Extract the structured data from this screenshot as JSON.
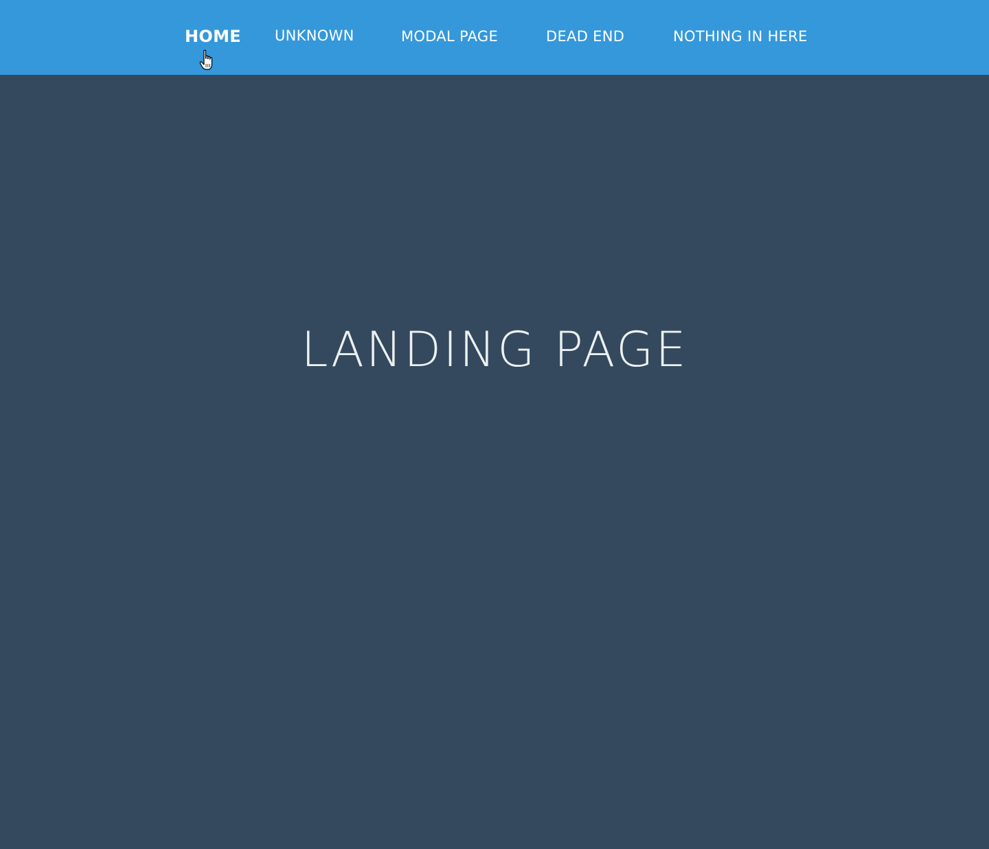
{
  "nav": {
    "items": [
      {
        "label": "HOME",
        "active": true
      },
      {
        "label": "UNKNOWN",
        "active": false
      },
      {
        "label": "MODAL PAGE",
        "active": false
      },
      {
        "label": "DEAD END",
        "active": false
      },
      {
        "label": "NOTHING IN HERE",
        "active": false
      }
    ]
  },
  "main": {
    "title": "LANDING PAGE"
  },
  "colors": {
    "navbar": "#3498db",
    "background": "#34495e",
    "text": "#ffffff"
  },
  "icons": {
    "cursor": "hand-pointer-icon"
  }
}
